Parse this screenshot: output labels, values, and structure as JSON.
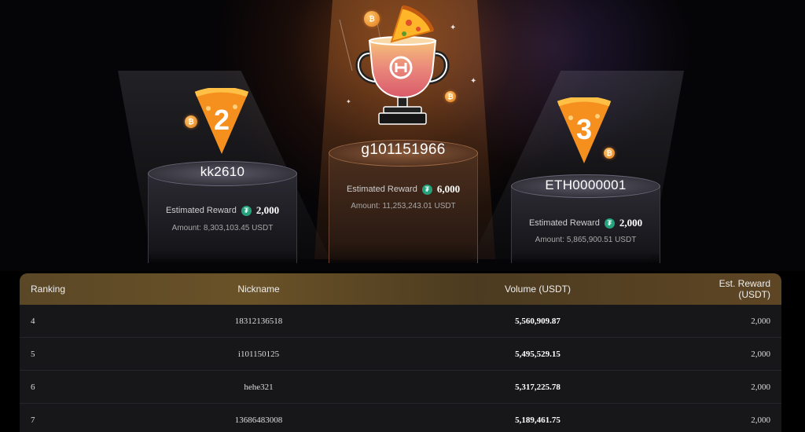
{
  "podiums": {
    "first": {
      "rank": "1",
      "nickname": "g101151966",
      "reward_label": "Estimated Reward",
      "reward_value": "6,000",
      "amount_label": "Amount:",
      "amount_value": "11,253,243.01 USDT"
    },
    "second": {
      "rank": "2",
      "nickname": "kk2610",
      "reward_label": "Estimated Reward",
      "reward_value": "2,000",
      "amount_label": "Amount:",
      "amount_value": "8,303,103.45 USDT"
    },
    "third": {
      "rank": "3",
      "nickname": "ETH0000001",
      "reward_label": "Estimated Reward",
      "reward_value": "2,000",
      "amount_label": "Amount:",
      "amount_value": "5,865,900.51 USDT"
    }
  },
  "table": {
    "headers": {
      "ranking": "Ranking",
      "nickname": "Nickname",
      "volume": "Volume (USDT)",
      "reward": "Est. Reward (USDT)"
    },
    "rows": [
      {
        "rank": "4",
        "nickname": "18312136518",
        "volume": "5,560,909.87",
        "reward": "2,000"
      },
      {
        "rank": "5",
        "nickname": "i101150125",
        "volume": "5,495,529.15",
        "reward": "2,000"
      },
      {
        "rank": "6",
        "nickname": "hehe321",
        "volume": "5,317,225.78",
        "reward": "2,000"
      },
      {
        "rank": "7",
        "nickname": "13686483008",
        "volume": "5,189,461.75",
        "reward": "2,000"
      }
    ]
  },
  "icons": {
    "trophy": "trophy-icon",
    "pizza": "pizza-slice-icon",
    "coin": "bitcoin-coin-icon",
    "tether": "tether-icon"
  },
  "colors": {
    "accent_orange": "#f28a1e",
    "tether_green": "#26a17b",
    "header_gold": "#5a4726"
  }
}
